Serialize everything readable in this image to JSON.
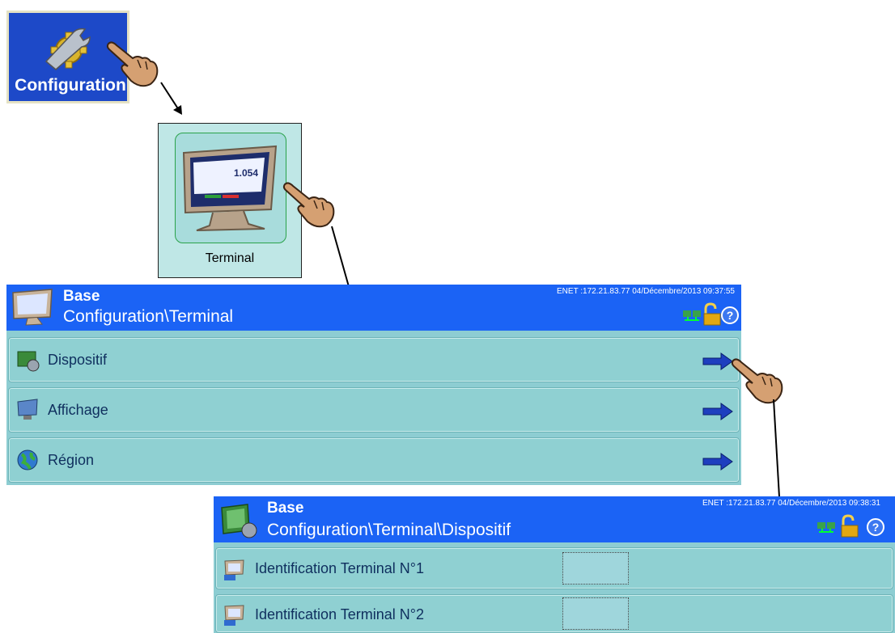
{
  "config_tile": {
    "label": "Configuration",
    "icon": "wrench-gear-icon"
  },
  "terminal_tile": {
    "label": "Terminal",
    "screen_readout": "1.054",
    "icon": "terminal-display-icon"
  },
  "screen1": {
    "title": "Base",
    "path": "Configuration\\Terminal",
    "status": "ENET :172.21.83.77  04/Décembre/2013 09:37:55",
    "items": [
      {
        "label": "Dispositif",
        "icon": "device-icon"
      },
      {
        "label": "Affichage",
        "icon": "monitor-icon"
      },
      {
        "label": "Région",
        "icon": "globe-icon"
      }
    ]
  },
  "screen2": {
    "title": "Base",
    "path": "Configuration\\Terminal\\Dispositif",
    "status": "ENET :172.21.83.77  04/Décembre/2013 09:38:31",
    "items": [
      {
        "label": "Identification Terminal N°1",
        "value": "",
        "icon": "terminal-id-icon"
      },
      {
        "label": "Identification Terminal N°2",
        "value": "",
        "icon": "terminal-id-icon"
      }
    ]
  },
  "colors": {
    "titlebar": "#1b63f5",
    "panel": "#8dcdd2",
    "config_tile": "#1d49c8",
    "arrow": "#1e3fbf"
  }
}
